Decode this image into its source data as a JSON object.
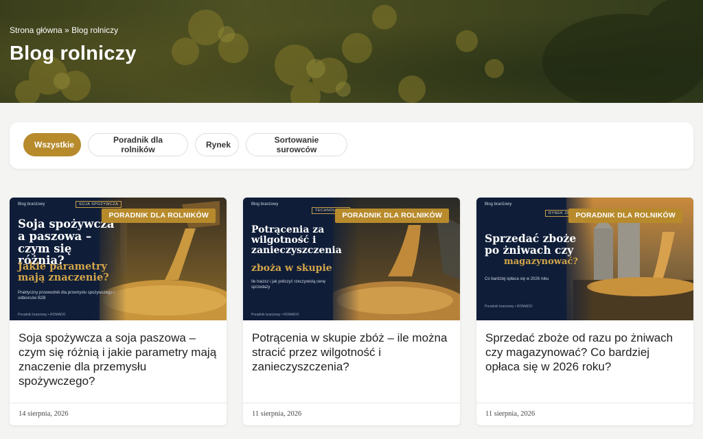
{
  "hero": {
    "breadcrumb_home": "Strona główna",
    "breadcrumb_sep": "»",
    "breadcrumb_current": "Blog rolniczy",
    "title": "Blog rolniczy"
  },
  "filters": [
    "Wszystkie",
    "Poradnik dla rolników",
    "Rynek",
    "Sortowanie surowców"
  ],
  "active_filter": "Wszystkie",
  "colors": {
    "accent": "#b78a2c",
    "thumb_navy": "#0f1d38",
    "thumb_gold": "#d4a64a"
  },
  "posts": [
    {
      "category": "PORADNIK DLA ROLNIKÓW",
      "title": "Soja spożywcza a soja paszowa – czym się różnią i jakie parametry mają znaczenie dla przemysłu spożywczego?",
      "date": "14 sierpnia, 2026",
      "thumb": {
        "brand": "Blog branżowy",
        "tag": "SOJA SPOŻYWCZA",
        "headline": "Soja spożywcza a paszowa – czym się różnią?",
        "highlight": "Jakie parametry mają znaczenie?",
        "sub": "Praktyczny przewodnik dla przemysłu spożywczego i odbiorców B2B",
        "footer": "Poradnik branżowy • ROMADO"
      }
    },
    {
      "category": "PORADNIK DLA ROLNIKÓW",
      "title": "Potrącenia w skupie zbóż – ile można stracić przez wilgotność i zanieczyszczenia?",
      "date": "11 sierpnia, 2026",
      "thumb": {
        "brand": "Blog branżowy",
        "tag": "TECHNOLOGIA",
        "headline": "Potrącenia za wilgotność i zanieczyszczenia",
        "highlight": "zboża w skupie",
        "sub": "Ile tracisz i jak policzyć rzeczywistą cenę sprzedaży",
        "footer": "Poradnik branżowy • ROMADO"
      }
    },
    {
      "category": "PORADNIK DLA ROLNIKÓW",
      "title": "Sprzedać zboże od razu po żniwach czy magazynować? Co bardziej opłaca się w 2026 roku?",
      "date": "11 sierpnia, 2026",
      "thumb": {
        "brand": "Blog branżowy",
        "tag": "RYNEK ZBÓŻ",
        "headline": "Sprzedać zboże po żniwach czy",
        "highlight": "magazynować?",
        "sub": "Co bardziej opłaca się w 2026 roku",
        "footer": "Poradnik branżowy • ROMADO"
      }
    }
  ]
}
